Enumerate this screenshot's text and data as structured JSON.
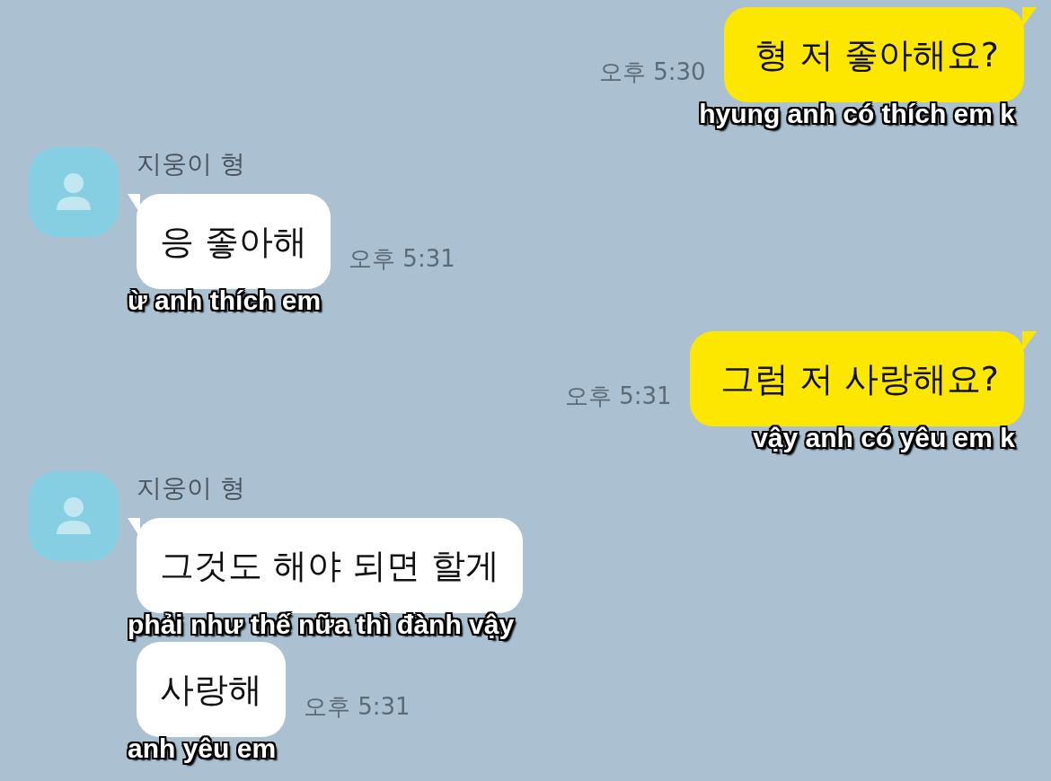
{
  "messages": [
    {
      "kind": "sent",
      "text": "형 저 좋아해요?",
      "time": "오후 5:30",
      "caption": "hyung anh có thích em k"
    },
    {
      "kind": "received",
      "sender": "지웅이 형",
      "text": "응 좋아해",
      "time": "오후 5:31",
      "caption": "ừ anh thích em"
    },
    {
      "kind": "sent",
      "text": "그럼 저 사랑해요?",
      "time": "오후 5:31",
      "caption": "vậy anh có yêu em k"
    },
    {
      "kind": "received",
      "sender": "지웅이 형",
      "text": "그것도 해야 되면 할게",
      "caption": "phải như thế nữa thì đành vậy"
    },
    {
      "kind": "received",
      "text": "사랑해",
      "time": "오후 5:31",
      "caption": "anh yêu em"
    }
  ]
}
